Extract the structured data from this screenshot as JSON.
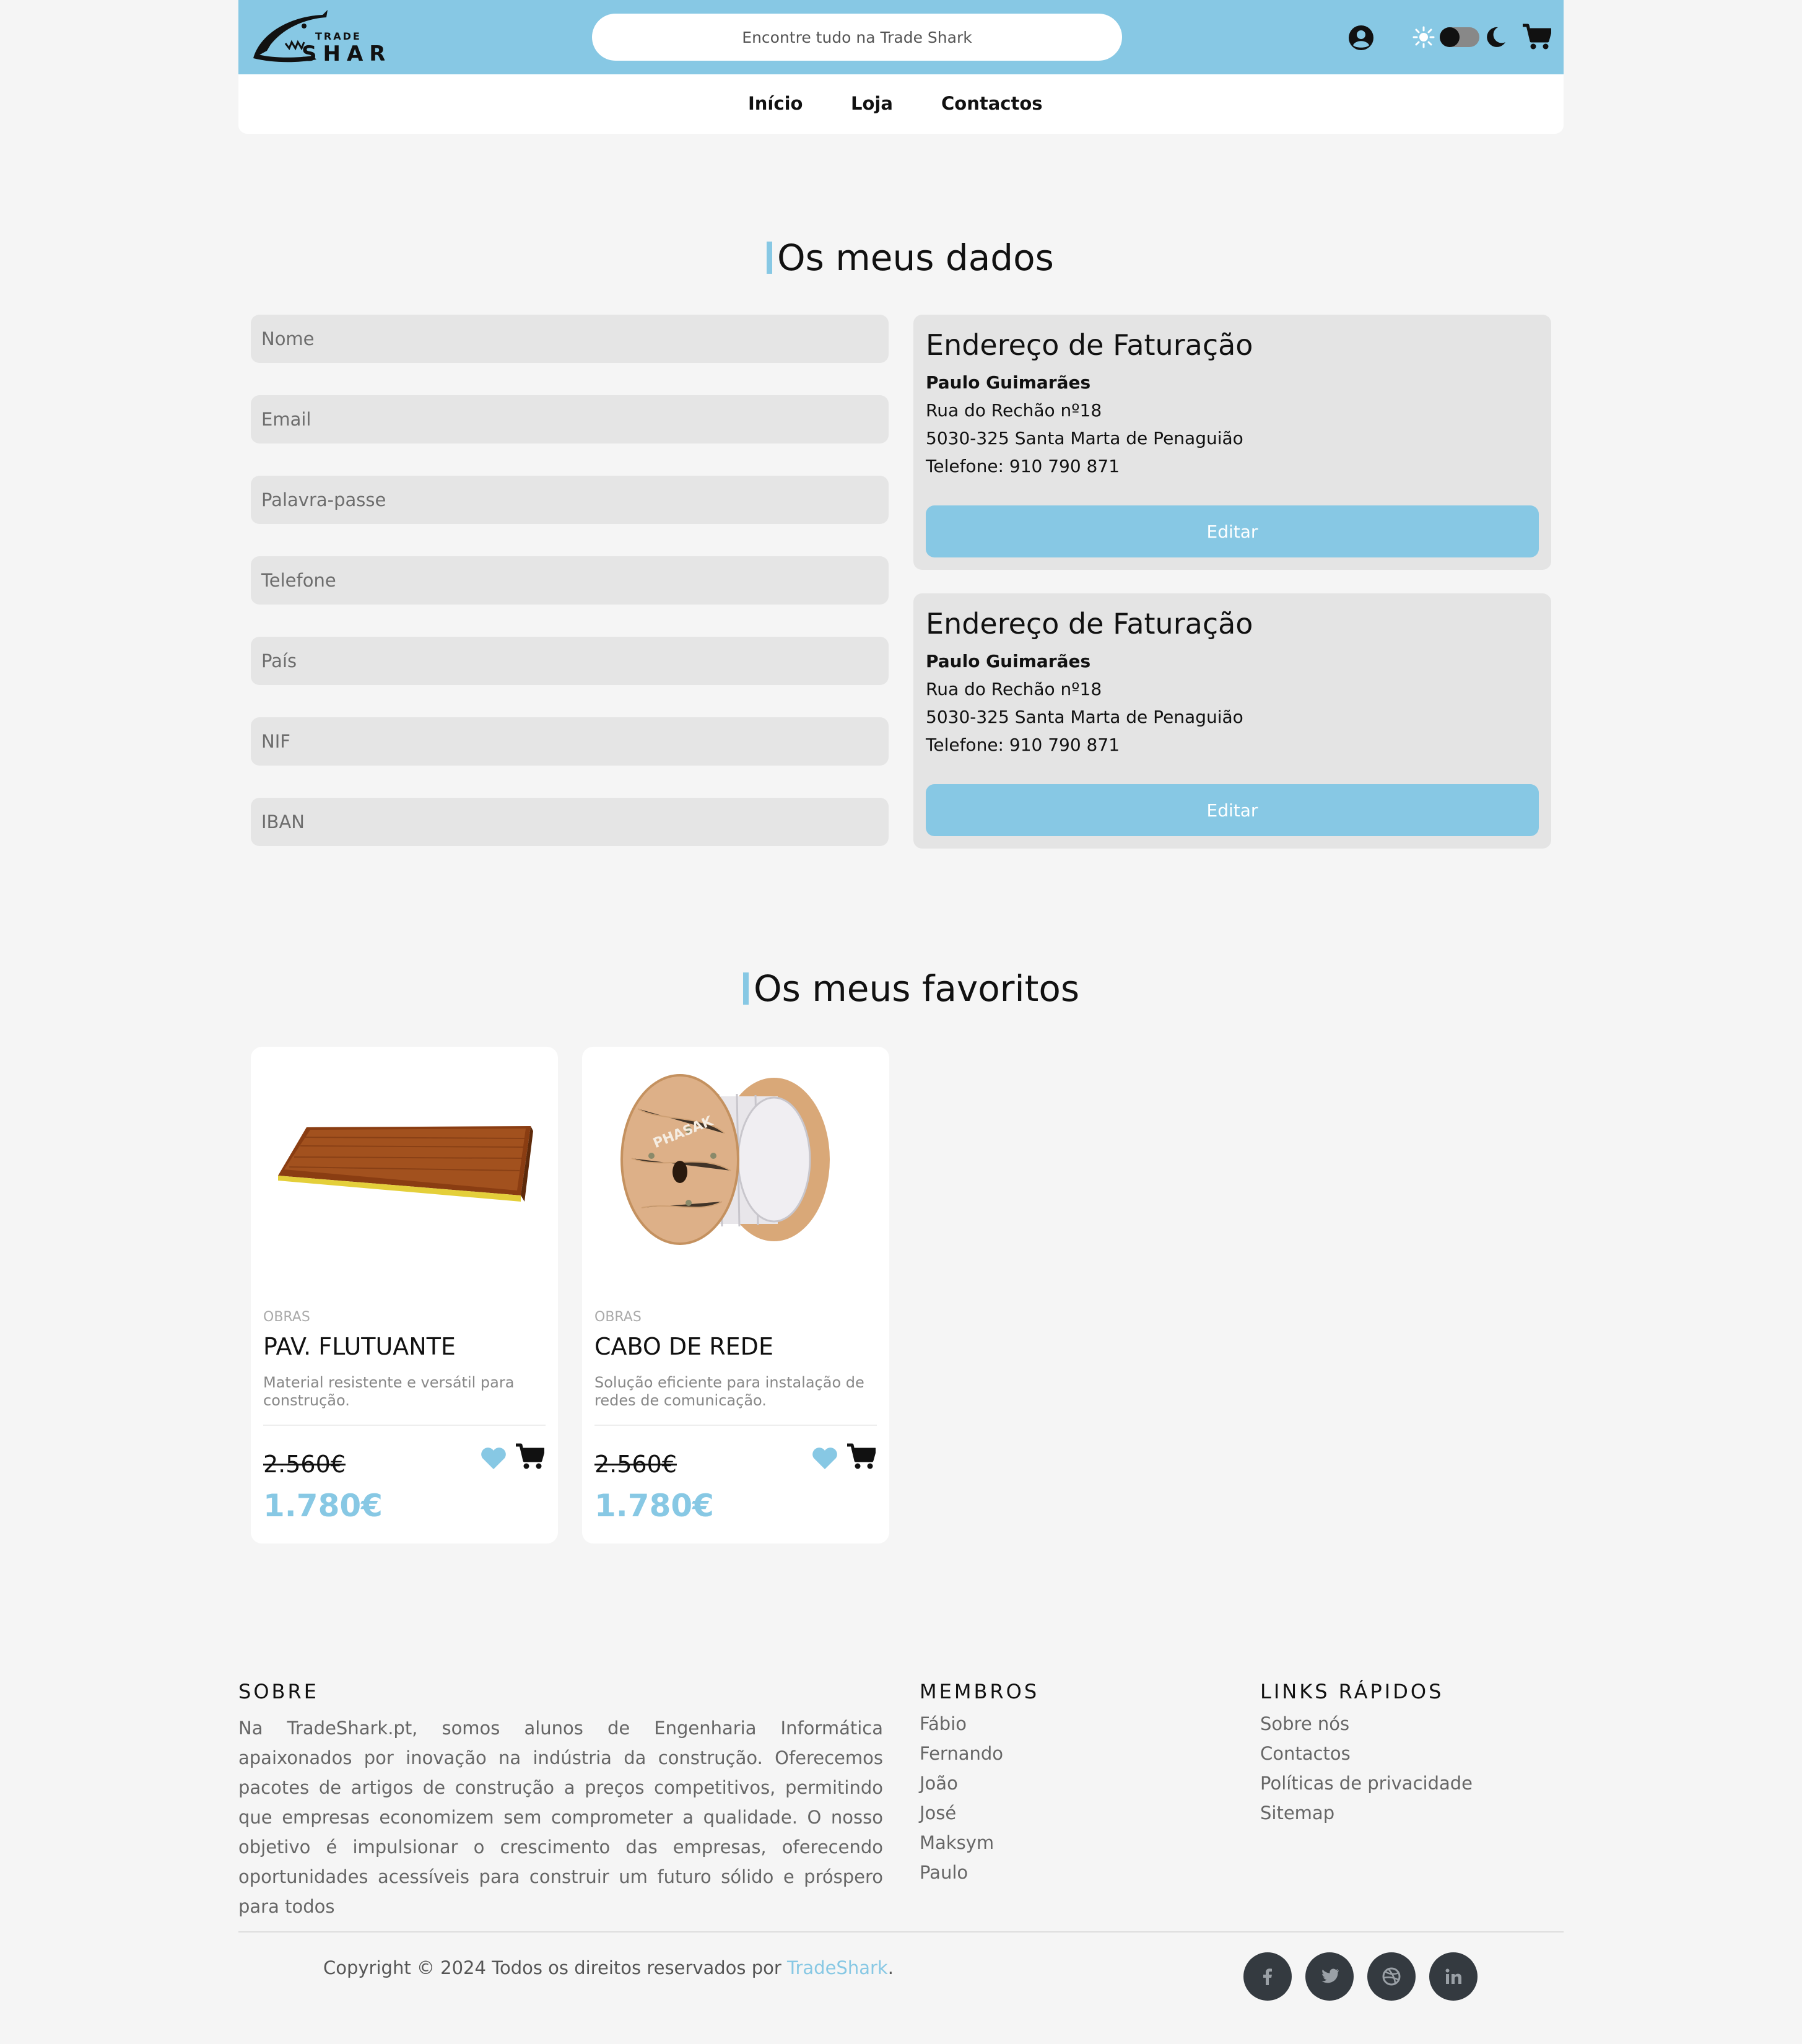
{
  "header": {
    "logo_top": "TRADE",
    "logo_main": "SHARK",
    "search_placeholder": "Encontre tudo na Trade Shark"
  },
  "nav": {
    "items": [
      "Início",
      "Loja",
      "Contactos"
    ]
  },
  "profile": {
    "title": "Os meus dados",
    "fields": [
      "Nome",
      "Email",
      "Palavra-passe",
      "Telefone",
      "País",
      "NIF",
      "IBAN"
    ]
  },
  "addresses": [
    {
      "title": "Endereço de Faturação",
      "name": "Paulo Guimarães",
      "street": "Rua do Rechão nº18",
      "city": "5030-325 Santa Marta de Penaguião",
      "phone": "Telefone: 910 790 871",
      "button": "Editar"
    },
    {
      "title": "Endereço de Faturação",
      "name": "Paulo Guimarães",
      "street": "Rua do Rechão nº18",
      "city": "5030-325 Santa Marta de Penaguião",
      "phone": "Telefone: 910 790 871",
      "button": "Editar"
    }
  ],
  "favorites": {
    "title": "Os meus favoritos",
    "products": [
      {
        "category": "OBRAS",
        "name": "PAV. FLUTUANTE",
        "description": "Material resistente e versátil para construção.",
        "old_price": "2.560€",
        "price": "1.780€",
        "image": "wood-floor-panel"
      },
      {
        "category": "OBRAS",
        "name": "CABO DE REDE",
        "description": "Solução eficiente para instalação de redes de comunicação.",
        "old_price": "2.560€",
        "price": "1.780€",
        "image": "cable-reel",
        "reel_label": "PHASAK"
      }
    ]
  },
  "footer": {
    "about_title": "SOBRE",
    "about_text": "Na TradeShark.pt, somos alunos de Engenharia Informática apaixonados por inovação na indústria da construção. Oferecemos pacotes de artigos de construção a preços competitivos, permitindo que empresas economizem sem comprometer a qualidade. O nosso objetivo é impulsionar o crescimento das empresas, oferecendo oportunidades acessíveis para construir um futuro sólido e próspero para todos",
    "members_title": "MEMBROS",
    "members": [
      "Fábio",
      "Fernando",
      "João",
      "José",
      "Maksym",
      "Paulo"
    ],
    "links_title": "LINKS RÁPIDOS",
    "links": [
      "Sobre nós",
      "Contactos",
      "Políticas de privacidade",
      "Sitemap"
    ],
    "copyright_prefix": "Copyright © 2024 Todos os direitos reservados por ",
    "copyright_brand": "TradeShark",
    "copyright_suffix": ".",
    "social": [
      "facebook-icon",
      "twitter-icon",
      "dribbble-icon",
      "linkedin-icon"
    ]
  },
  "colors": {
    "accent": "#87c8e4",
    "background": "#f5f5f5",
    "field": "#e5e5e5",
    "social": "#343a40"
  }
}
